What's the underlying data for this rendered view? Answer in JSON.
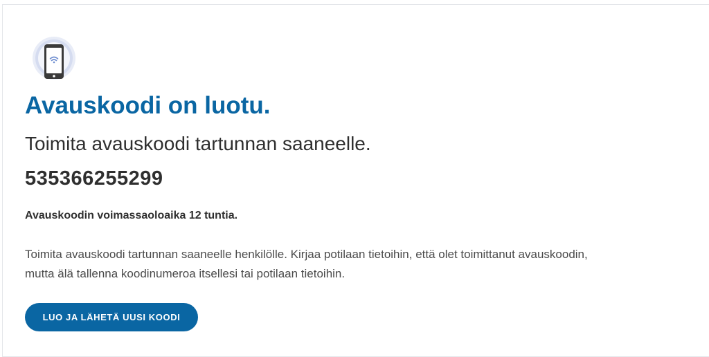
{
  "title": "Avauskoodi on luotu.",
  "subtitle": "Toimita avauskoodi tartunnan saaneelle.",
  "code": "535366255299",
  "validity": "Avauskoodin voimassaoloaika 12 tuntia.",
  "instructions": {
    "line1": "Toimita avauskoodi tartunnan saaneelle henkilölle. Kirjaa potilaan tietoihin, että olet toimittanut avauskoodin,",
    "line2": "mutta älä tallenna koodinumeroa itsellesi tai potilaan tietoihin."
  },
  "button": {
    "label": "LUO JA LÄHETÄ UUSI KOODI"
  },
  "colors": {
    "accent": "#0a66a3",
    "text": "#2f2f2f",
    "muted_text": "#4a4a4a",
    "icon_ring": "#c9d3ec"
  },
  "icons": {
    "illustration": "phone-wifi-icon"
  }
}
